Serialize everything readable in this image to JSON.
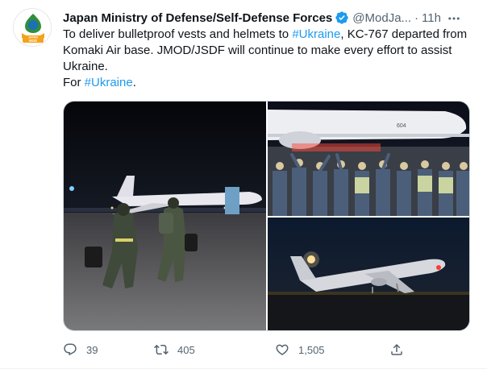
{
  "tweet": {
    "author_name": "Japan Ministry of Defense/Self-Defense Forces",
    "author_handle": "@ModJa...",
    "separator": "·",
    "timestamp": "11h",
    "avatar_text": "JAPAN MOD",
    "text_line1_prefix": "To deliver bulletproof vests and helmets to ",
    "hashtag1": "#Ukraine",
    "text_line1_suffix": ", KC-767 departed from Komaki Air base. JMOD/JSDF will continue to make every effort to assist Ukraine.",
    "text_line2_prefix": "For ",
    "hashtag2": "#Ukraine",
    "text_line2_suffix": ".",
    "aircraft_number": "604"
  },
  "actions": {
    "reply_count": "39",
    "retweet_count": "405",
    "like_count": "1,505"
  },
  "icons": {
    "verified": "verified-badge-icon",
    "more": "more-icon",
    "reply": "reply-icon",
    "retweet": "retweet-icon",
    "like": "heart-icon",
    "share": "share-icon"
  },
  "colors": {
    "accent": "#1d9bf0",
    "text": "#0f1419",
    "secondary": "#536471",
    "avatar_orange": "#f5a21a",
    "avatar_blue": "#1d6fb8"
  }
}
